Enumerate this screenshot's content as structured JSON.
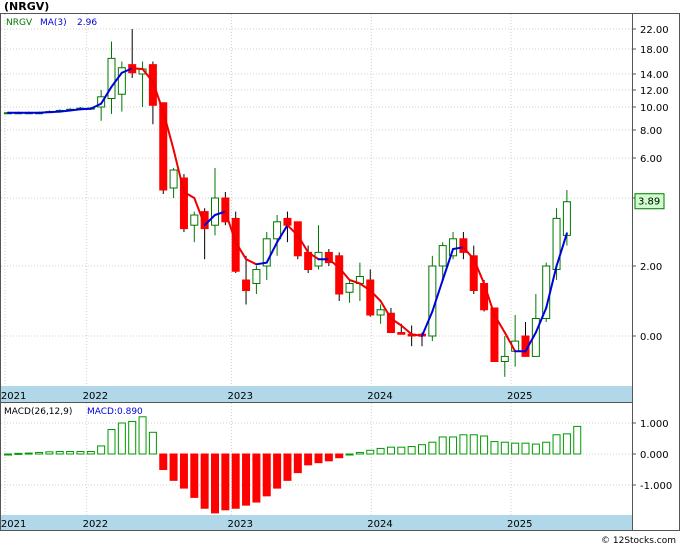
{
  "header": {
    "title": "(NRGV)"
  },
  "footer": {
    "credit": "© 12Stocks.com"
  },
  "colors": {
    "up_candle_fill": "#ffffff",
    "up_candle_border": "#007700",
    "down_candle_fill": "#ff0000",
    "ma_up": "#0000dd",
    "ma_down": "#ee0000",
    "macd_bar_up": "#009900",
    "macd_bar_down": "#ff0000",
    "axis_strip": "#b0d8e8",
    "grid": "#d0d0d0",
    "price_badge": "#ccffcc"
  },
  "chart_data": [
    {
      "type": "candlestick",
      "name": "price",
      "legend": {
        "ticker": "NRGV",
        "ma_label": "MA(3)",
        "ma_value": "2.96"
      },
      "yscale": "log",
      "y_tick_labels": [
        "22.00",
        "18.00",
        "14.00",
        "12.00",
        "10.00",
        "8.00",
        "6.00",
        "4.00",
        "2.00",
        "0.00"
      ],
      "y_tick_values": [
        22,
        18,
        14,
        12,
        10,
        8,
        6,
        4,
        2,
        0
      ],
      "x_tick_labels": [
        "2021",
        "2022",
        "2023",
        "2024",
        "2025"
      ],
      "last_price": "3.89",
      "candles": [
        {
          "o": 9.5,
          "h": 9.6,
          "l": 9.4,
          "c": 9.5
        },
        {
          "o": 9.5,
          "h": 9.6,
          "l": 9.4,
          "c": 9.5
        },
        {
          "o": 9.5,
          "h": 9.6,
          "l": 9.4,
          "c": 9.5
        },
        {
          "o": 9.5,
          "h": 9.6,
          "l": 9.4,
          "c": 9.5
        },
        {
          "o": 9.6,
          "h": 9.7,
          "l": 9.5,
          "c": 9.6
        },
        {
          "o": 9.7,
          "h": 9.8,
          "l": 9.6,
          "c": 9.7
        },
        {
          "o": 9.8,
          "h": 9.9,
          "l": 9.7,
          "c": 9.8
        },
        {
          "o": 9.9,
          "h": 10.0,
          "l": 9.8,
          "c": 9.9
        },
        {
          "o": 9.9,
          "h": 10.0,
          "l": 9.8,
          "c": 9.9
        },
        {
          "o": 10.0,
          "h": 12.0,
          "l": 8.8,
          "c": 11.2
        },
        {
          "o": 11.0,
          "h": 19.5,
          "l": 9.4,
          "c": 16.5
        },
        {
          "o": 11.5,
          "h": 16.0,
          "l": 9.6,
          "c": 15.0
        },
        {
          "o": 15.5,
          "h": 22.0,
          "l": 13.5,
          "c": 14.2
        },
        {
          "o": 14.0,
          "h": 16.0,
          "l": 10.0,
          "c": 14.8
        },
        {
          "o": 15.5,
          "h": 16.0,
          "l": 8.5,
          "c": 10.2
        },
        {
          "o": 10.5,
          "h": 10.5,
          "l": 4.2,
          "c": 4.4
        },
        {
          "o": 4.5,
          "h": 5.5,
          "l": 4.0,
          "c": 5.4
        },
        {
          "o": 5.0,
          "h": 5.2,
          "l": 3.0,
          "c": 3.1
        },
        {
          "o": 3.2,
          "h": 3.6,
          "l": 2.7,
          "c": 3.5
        },
        {
          "o": 3.6,
          "h": 3.7,
          "l": 2.2,
          "c": 3.1
        },
        {
          "o": 3.2,
          "h": 5.5,
          "l": 2.9,
          "c": 4.0
        },
        {
          "o": 4.0,
          "h": 4.3,
          "l": 3.2,
          "c": 3.3
        },
        {
          "o": 3.4,
          "h": 3.6,
          "l": 1.8,
          "c": 1.85
        },
        {
          "o": 1.6,
          "h": 2.3,
          "l": 0.9,
          "c": 1.3
        },
        {
          "o": 1.5,
          "h": 2.0,
          "l": 1.2,
          "c": 1.9
        },
        {
          "o": 2.0,
          "h": 3.0,
          "l": 1.6,
          "c": 2.8
        },
        {
          "o": 2.8,
          "h": 3.5,
          "l": 2.3,
          "c": 3.3
        },
        {
          "o": 3.4,
          "h": 3.6,
          "l": 2.7,
          "c": 3.2
        },
        {
          "o": 3.3,
          "h": 3.3,
          "l": 2.2,
          "c": 2.3
        },
        {
          "o": 2.4,
          "h": 2.6,
          "l": 1.8,
          "c": 1.9
        },
        {
          "o": 2.0,
          "h": 3.2,
          "l": 1.9,
          "c": 2.4
        },
        {
          "o": 2.4,
          "h": 2.5,
          "l": 2.0,
          "c": 2.1
        },
        {
          "o": 2.3,
          "h": 2.4,
          "l": 1.0,
          "c": 1.2
        },
        {
          "o": 1.25,
          "h": 1.6,
          "l": 0.95,
          "c": 1.5
        },
        {
          "o": 1.5,
          "h": 2.1,
          "l": 1.0,
          "c": 1.7
        },
        {
          "o": 1.6,
          "h": 1.9,
          "l": 0.55,
          "c": 0.6
        },
        {
          "o": 0.6,
          "h": 0.9,
          "l": 0.35,
          "c": 0.75
        },
        {
          "o": 0.65,
          "h": 0.8,
          "l": 0.1,
          "c": 0.1
        },
        {
          "o": 0.1,
          "h": 0.35,
          "l": 0.05,
          "c": 0.05
        },
        {
          "o": 0.05,
          "h": 0.3,
          "l": -0.1,
          "c": 0.0
        },
        {
          "o": 0.05,
          "h": 0.1,
          "l": -0.1,
          "c": 0.0
        },
        {
          "o": 0.0,
          "h": 2.3,
          "l": -0.05,
          "c": 2.0
        },
        {
          "o": 2.0,
          "h": 2.7,
          "l": 1.6,
          "c": 2.6
        },
        {
          "o": 2.3,
          "h": 3.0,
          "l": 2.2,
          "c": 2.8
        },
        {
          "o": 2.8,
          "h": 3.0,
          "l": 2.2,
          "c": 2.4
        },
        {
          "o": 2.3,
          "h": 2.6,
          "l": 1.2,
          "c": 1.3
        },
        {
          "o": 1.5,
          "h": 1.6,
          "l": 0.7,
          "c": 0.75
        },
        {
          "o": 0.8,
          "h": 0.8,
          "l": -0.2,
          "c": -0.25
        },
        {
          "o": -0.25,
          "h": 0.0,
          "l": -0.4,
          "c": -0.2
        },
        {
          "o": -0.15,
          "h": 0.6,
          "l": -0.3,
          "c": -0.05
        },
        {
          "o": 0.0,
          "h": 0.4,
          "l": -0.15,
          "c": -0.2
        },
        {
          "o": -0.2,
          "h": 1.2,
          "l": -0.2,
          "c": 0.5
        },
        {
          "o": 0.5,
          "h": 2.1,
          "l": 0.4,
          "c": 2.0
        },
        {
          "o": 1.9,
          "h": 3.7,
          "l": 1.6,
          "c": 3.4
        },
        {
          "o": 2.9,
          "h": 4.4,
          "l": 2.6,
          "c": 3.89
        }
      ],
      "ma3": [
        9.5,
        9.5,
        9.5,
        9.5,
        9.55,
        9.6,
        9.7,
        9.8,
        9.85,
        10.4,
        12.4,
        14.2,
        14.9,
        14.8,
        13.0,
        9.6,
        6.6,
        4.3,
        4.0,
        3.2,
        3.5,
        3.6,
        2.7,
        2.2,
        2.05,
        2.1,
        2.7,
        3.2,
        2.9,
        2.4,
        2.2,
        2.2,
        1.95,
        1.6,
        1.5,
        1.3,
        1.0,
        0.5,
        0.3,
        0.05,
        0.0,
        0.7,
        1.6,
        2.5,
        2.55,
        2.2,
        1.5,
        0.6,
        0.1,
        -0.15,
        -0.15,
        0.1,
        0.8,
        2.0,
        2.96
      ]
    },
    {
      "type": "bar",
      "name": "macd",
      "legend": {
        "label": "MACD(26,12,9)",
        "value_label": "MACD:0.890"
      },
      "y_tick_labels": [
        "1.000",
        "0.000",
        "-1.000"
      ],
      "y_tick_values": [
        1,
        0,
        -1
      ],
      "x_tick_labels": [
        "2021",
        "2022",
        "2023",
        "2024",
        "2025"
      ],
      "values": [
        0.0,
        0.02,
        0.03,
        0.05,
        0.07,
        0.08,
        0.08,
        0.08,
        0.08,
        0.26,
        0.79,
        1.0,
        1.05,
        1.2,
        0.7,
        -0.5,
        -0.85,
        -1.1,
        -1.4,
        -1.75,
        -1.9,
        -1.8,
        -1.75,
        -1.65,
        -1.55,
        -1.35,
        -1.1,
        -0.85,
        -0.6,
        -0.35,
        -0.28,
        -0.22,
        -0.12,
        0.0,
        0.05,
        0.12,
        0.18,
        0.22,
        0.22,
        0.24,
        0.3,
        0.38,
        0.55,
        0.55,
        0.62,
        0.62,
        0.58,
        0.4,
        0.38,
        0.35,
        0.35,
        0.32,
        0.38,
        0.62,
        0.65,
        0.89
      ]
    }
  ]
}
